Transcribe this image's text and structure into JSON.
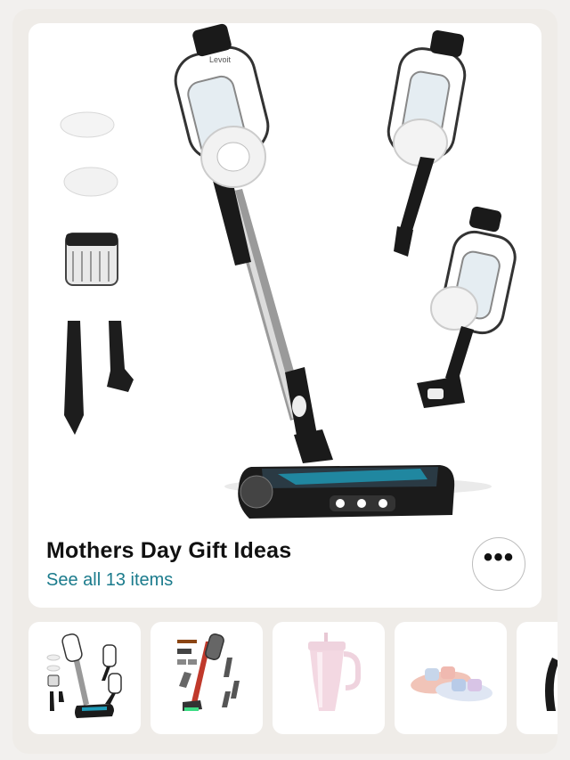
{
  "carousel": {
    "title": "Mothers Day Gift Ideas",
    "see_all": "See all 13 items",
    "more_icon": "ellipsis-icon",
    "hero_image": "cordless-stick-vacuum-with-accessories",
    "brand_mark": "LEVOIT",
    "thumbnails": [
      {
        "item": "cordless-stick-vacuum"
      },
      {
        "item": "cordless-vacuum-set-red"
      },
      {
        "item": "pink-insulated-tumbler"
      },
      {
        "item": "tie-dye-slide-sandals"
      },
      {
        "item": "partial-product-black"
      }
    ]
  },
  "colors": {
    "link": "#1b7b8c",
    "page_bg": "#efece8",
    "card_bg": "#ffffff"
  }
}
